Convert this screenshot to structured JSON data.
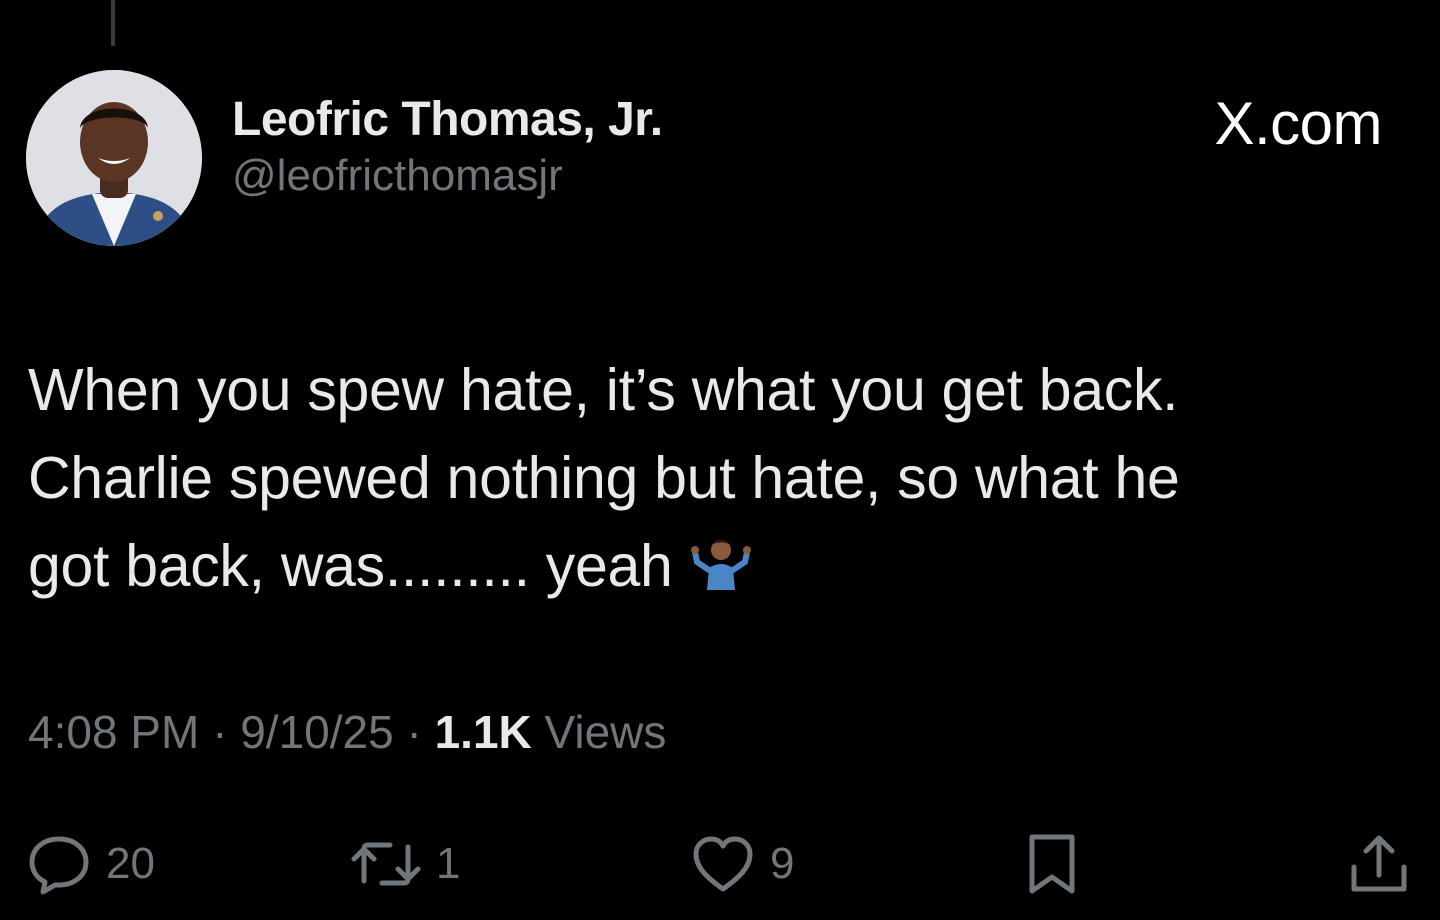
{
  "author": {
    "display_name": "Leofric Thomas, Jr.",
    "handle": "@leofricthomasjr"
  },
  "brand": {
    "label": "X.com"
  },
  "tweet": {
    "lines": [
      "When you spew hate, it’s what you get back.",
      "Charlie spewed nothing but hate, so what he",
      "got back, was......... yeah"
    ],
    "emoji": "person-shrugging-icon"
  },
  "meta": {
    "time": "4:08 PM",
    "separator": "·",
    "date": "9/10/25",
    "views_count": "1.1K",
    "views_label": "Views"
  },
  "actions": {
    "replies": "20",
    "reposts": "1",
    "likes": "9"
  },
  "colors": {
    "background": "#000000",
    "primary_text": "#e7e9ea",
    "secondary_text": "#71767b"
  }
}
